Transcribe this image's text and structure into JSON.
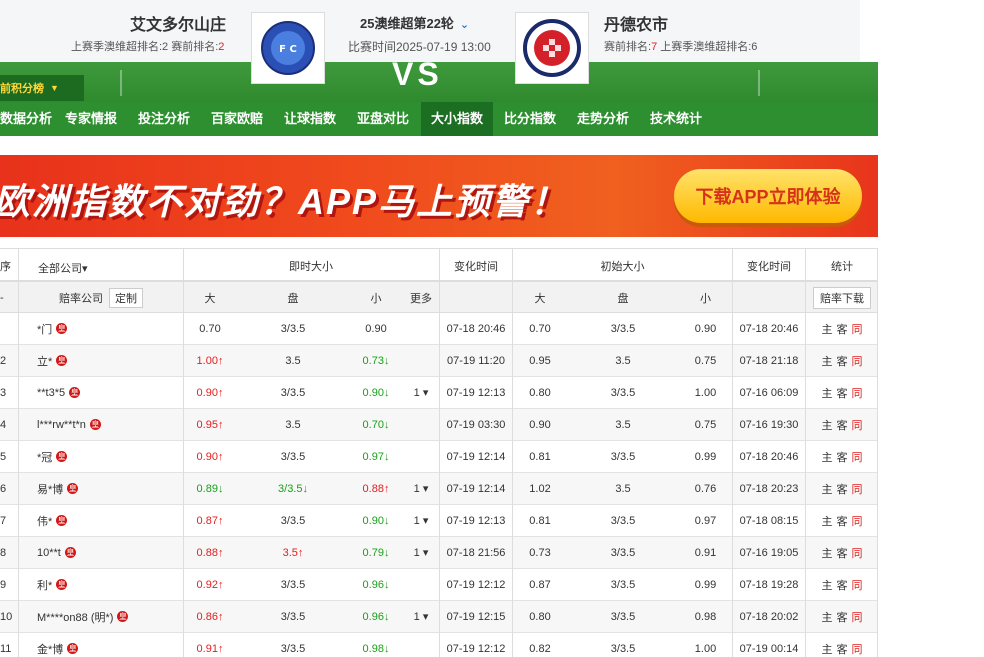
{
  "match": {
    "home_team": "艾文多尔山庄",
    "home_sub_prefix": "上赛季澳维超排名:2   赛前排名:",
    "home_rank": "2",
    "away_team": "丹德农市",
    "away_sub_prefix": "赛前排名:",
    "away_rank": "7",
    "away_sub_suffix": "   上赛季澳维超排名:6",
    "league_round": "25澳维超第22轮",
    "match_time": "比赛时间2025-07-19 13:00",
    "vs": "VS",
    "home_logo_text": "AVONDALE F.C.",
    "away_logo_text": "DANDENONG CITY S.C."
  },
  "nav": {
    "score_btn": "前积分榜",
    "items": [
      "数据分析",
      "专家情报",
      "投注分析",
      "百家欧赔",
      "让球指数",
      "亚盘对比",
      "大小指数",
      "比分指数",
      "走势分析",
      "技术统计"
    ],
    "active": "大小指数"
  },
  "banner": {
    "text": "欧洲指数不对劲？APP马上预警！",
    "button": "下载APP立即体验"
  },
  "table": {
    "h1": {
      "c0": "序",
      "company": "全部公司▾",
      "live": "即时大小",
      "change_time": "变化时间",
      "init": "初始大小",
      "change_time2": "变化时间",
      "stats": "统计"
    },
    "h2": {
      "c0": "-",
      "company": "赔率公司",
      "custom": "定制",
      "over": "大",
      "line": "盘",
      "under": "小",
      "more": "更多",
      "over2": "大",
      "line2": "盘",
      "under2": "小",
      "download": "赔率下载"
    },
    "rows": [
      {
        "idx": "",
        "name": "*门",
        "o": "0.70",
        "od": "",
        "l": "3/3.5",
        "ld": "",
        "u": "0.90",
        "ud": "",
        "more": "",
        "t": "07-18 20:46",
        "io": "0.70",
        "il": "3/3.5",
        "iu": "0.90",
        "it": "07-18 20:46"
      },
      {
        "idx": "2",
        "name": "立*",
        "o": "1.00↑",
        "od": "up",
        "l": "3.5",
        "ld": "",
        "u": "0.73↓",
        "ud": "down",
        "more": "",
        "t": "07-19 11:20",
        "io": "0.95",
        "il": "3.5",
        "iu": "0.75",
        "it": "07-18 21:18"
      },
      {
        "idx": "3",
        "name": "**t3*5",
        "o": "0.90↑",
        "od": "up",
        "l": "3/3.5",
        "ld": "",
        "u": "0.90↓",
        "ud": "down",
        "more": "1 ▾",
        "t": "07-19 12:13",
        "io": "0.80",
        "il": "3/3.5",
        "iu": "1.00",
        "it": "07-16 06:09"
      },
      {
        "idx": "4",
        "name": "l***rw**t*n",
        "o": "0.95↑",
        "od": "up",
        "l": "3.5",
        "ld": "",
        "u": "0.70↓",
        "ud": "down",
        "more": "",
        "t": "07-19 03:30",
        "io": "0.90",
        "il": "3.5",
        "iu": "0.75",
        "it": "07-16 19:30"
      },
      {
        "idx": "5",
        "name": "*冠",
        "o": "0.90↑",
        "od": "up",
        "l": "3/3.5",
        "ld": "",
        "u": "0.97↓",
        "ud": "down",
        "more": "",
        "t": "07-19 12:14",
        "io": "0.81",
        "il": "3/3.5",
        "iu": "0.99",
        "it": "07-18 20:46"
      },
      {
        "idx": "6",
        "name": "易*博",
        "o": "0.89↓",
        "od": "down",
        "l": "3/3.5↓",
        "ld": "down",
        "u": "0.88↑",
        "ud": "up",
        "more": "1 ▾",
        "t": "07-19 12:14",
        "io": "1.02",
        "il": "3.5",
        "iu": "0.76",
        "it": "07-18 20:23"
      },
      {
        "idx": "7",
        "name": "伟*",
        "o": "0.87↑",
        "od": "up",
        "l": "3/3.5",
        "ld": "",
        "u": "0.90↓",
        "ud": "down",
        "more": "1 ▾",
        "t": "07-19 12:13",
        "io": "0.81",
        "il": "3/3.5",
        "iu": "0.97",
        "it": "07-18 08:15"
      },
      {
        "idx": "8",
        "name": "10**t",
        "o": "0.88↑",
        "od": "up",
        "l": "3.5↑",
        "ld": "up",
        "u": "0.79↓",
        "ud": "down",
        "more": "1 ▾",
        "t": "07-18 21:56",
        "io": "0.73",
        "il": "3/3.5",
        "iu": "0.91",
        "it": "07-16 19:05"
      },
      {
        "idx": "9",
        "name": "利*",
        "o": "0.92↑",
        "od": "up",
        "l": "3/3.5",
        "ld": "",
        "u": "0.96↓",
        "ud": "down",
        "more": "",
        "t": "07-19 12:12",
        "io": "0.87",
        "il": "3/3.5",
        "iu": "0.99",
        "it": "07-18 19:28"
      },
      {
        "idx": "10",
        "name": "M****on88 (明*)",
        "o": "0.86↑",
        "od": "up",
        "l": "3/3.5",
        "ld": "",
        "u": "0.96↓",
        "ud": "down",
        "more": "1 ▾",
        "t": "07-19 12:15",
        "io": "0.80",
        "il": "3/3.5",
        "iu": "0.98",
        "it": "07-18 20:02"
      },
      {
        "idx": "11",
        "name": "金*博",
        "o": "0.91↑",
        "od": "up",
        "l": "3/3.5",
        "ld": "",
        "u": "0.98↓",
        "ud": "down",
        "more": "",
        "t": "07-19 12:12",
        "io": "0.82",
        "il": "3/3.5",
        "iu": "1.00",
        "it": "07-19 00:14"
      }
    ],
    "stat_labels": {
      "zhu": "主",
      "ke": "客",
      "tong": "同"
    },
    "crown_char": "皇"
  }
}
